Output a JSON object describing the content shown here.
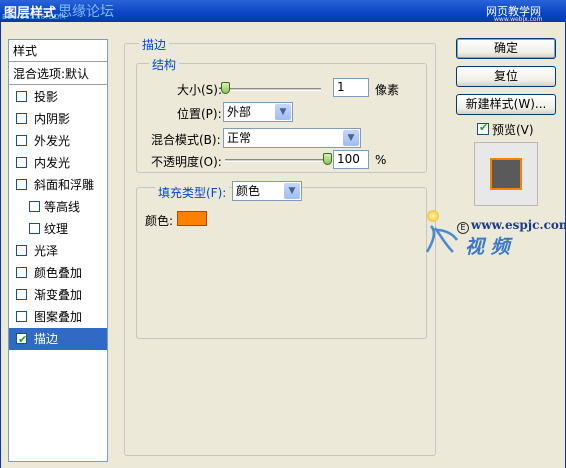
{
  "window": {
    "title": "图层样式",
    "watermark_left": "思缘论坛",
    "watermark_bbs": "BBS.16XX8.COM",
    "watermark_right": "网页教学网",
    "watermark_right_url": "www.webjx.com"
  },
  "styles_panel": {
    "header": "样式",
    "blend_options": "混合选项:默认",
    "items": [
      {
        "label": "投影",
        "checked": false,
        "sub": false
      },
      {
        "label": "内阴影",
        "checked": false,
        "sub": false
      },
      {
        "label": "外发光",
        "checked": false,
        "sub": false
      },
      {
        "label": "内发光",
        "checked": false,
        "sub": false
      },
      {
        "label": "斜面和浮雕",
        "checked": false,
        "sub": false
      },
      {
        "label": "等高线",
        "checked": false,
        "sub": true
      },
      {
        "label": "纹理",
        "checked": false,
        "sub": true
      },
      {
        "label": "光泽",
        "checked": false,
        "sub": false
      },
      {
        "label": "颜色叠加",
        "checked": false,
        "sub": false
      },
      {
        "label": "渐变叠加",
        "checked": false,
        "sub": false
      },
      {
        "label": "图案叠加",
        "checked": false,
        "sub": false
      },
      {
        "label": "描边",
        "checked": true,
        "sub": false,
        "selected": true
      }
    ]
  },
  "stroke": {
    "group_title": "描边",
    "structure_title": "结构",
    "size_label": "大小(S):",
    "size_value": "1",
    "size_unit": "像素",
    "position_label": "位置(P):",
    "position_value": "外部",
    "blend_mode_label": "混合模式(B):",
    "blend_mode_value": "正常",
    "opacity_label": "不透明度(O):",
    "opacity_value": "100",
    "opacity_unit": "%",
    "fill_type_label": "填充类型(F):",
    "fill_type_value": "颜色",
    "color_label": "颜色:",
    "color_hex": "#ff7f00",
    "size_slider_fraction": 0.0,
    "opacity_slider_fraction": 1.0
  },
  "buttons": {
    "ok": "确定",
    "reset": "复位",
    "new_style": "新建样式(W)...",
    "preview_label": "预览(V)",
    "preview_checked": true
  },
  "watermark": {
    "site": "www.espjc.com",
    "badge": "E",
    "logo": "视 频"
  }
}
